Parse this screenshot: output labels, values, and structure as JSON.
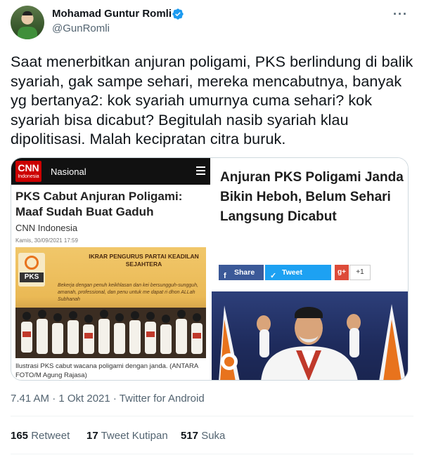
{
  "author": {
    "name": "Mohamad Guntur Romli",
    "handle": "@GunRomli",
    "verified": true
  },
  "tweet": {
    "text": "Saat menerbitkan anjuran poligami, PKS berlindung di balik syariah, gak sampe sehari, mereka mencabutnya, banyak yg bertanya2: kok syariah umurnya cuma sehari? kok syariah bisa dicabut? Begitulah nasib syariah klau dipolitisasi. Malah kecipratan citra buruk.",
    "timestamp": "7.41 AM · 1 Okt 2021 · Twitter for Android"
  },
  "media_left": {
    "logo": "CNN",
    "logo_sub": "Indonesia",
    "section": "Nasional",
    "headline": "PKS Cabut Anjuran Poligami: Maaf Sudah Buat Gaduh",
    "source": "CNN Indonesia",
    "date": "Kamis, 30/09/2021 17:59",
    "photo_logo": "PKS",
    "photo_banner": "IKRAR PENGURUS PARTAI KEADILAN SEJAHTERA",
    "photo_text": "Bekerja dengan penuh keikhlasan dan kei bersungguh-sungguh, amanah, professional, dan penu untuk me dapat ri dhon ALLah Subhanah",
    "caption": "Ilustrasi PKS cabut wacana poligami dengan janda. (ANTARA FOTO/M Agung Rajasa)"
  },
  "media_right": {
    "headline": "Anjuran PKS Poligami Janda Bikin Heboh, Belum Sehari Langsung Dicabut",
    "share_label": "Share",
    "tweet_label": "Tweet",
    "gplus_label": "g+",
    "gplus_count": "+1"
  },
  "stats": {
    "retweets_count": "165",
    "retweets_label": "Retweet",
    "quotes_count": "17",
    "quotes_label": "Tweet Kutipan",
    "likes_count": "517",
    "likes_label": "Suka"
  },
  "icons": {
    "more": "more-options-icon",
    "verified": "verified-badge-icon"
  },
  "colors": {
    "verified_blue": "#1d9bf0",
    "text_primary": "#0f1419",
    "text_secondary": "#536471",
    "cnn_red": "#cc0000",
    "facebook_blue": "#3b5998",
    "twitter_blue": "#1da1f2",
    "gplus_red": "#dd4b39"
  }
}
